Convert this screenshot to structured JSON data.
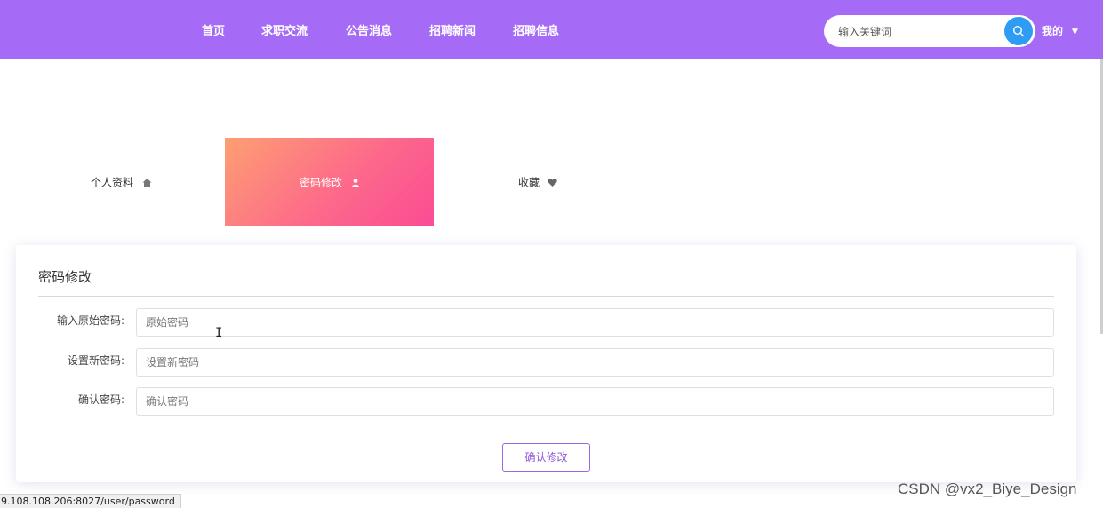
{
  "header": {
    "nav": [
      "首页",
      "求职交流",
      "公告消息",
      "招聘新闻",
      "招聘信息"
    ],
    "search_placeholder": "输入关键词",
    "search_icon": "search-icon",
    "user_menu_label": "我的",
    "user_menu_caret": "▼"
  },
  "colors": {
    "header_bg": "#a56bf7",
    "search_button": "#2e9bf5",
    "active_tab_gradient": [
      "#fd9f72",
      "#fb4c94"
    ],
    "button_accent": "#8a55d8"
  },
  "tabs": [
    {
      "label": "个人资料",
      "icon": "home-icon",
      "active": false
    },
    {
      "label": "密码修改",
      "icon": "user-icon",
      "active": true
    },
    {
      "label": "收藏",
      "icon": "heart-icon",
      "active": false
    }
  ],
  "form": {
    "title": "密码修改",
    "fields": [
      {
        "label": "输入原始密码:",
        "placeholder": "原始密码",
        "value": ""
      },
      {
        "label": "设置新密码:",
        "placeholder": "设置新密码",
        "value": ""
      },
      {
        "label": "确认密码:",
        "placeholder": "确认密码",
        "value": ""
      }
    ],
    "submit_label": "确认修改"
  },
  "status_bar_url": "9.108.108.206:8027/user/password",
  "watermark": "CSDN @vx2_Biye_Design"
}
